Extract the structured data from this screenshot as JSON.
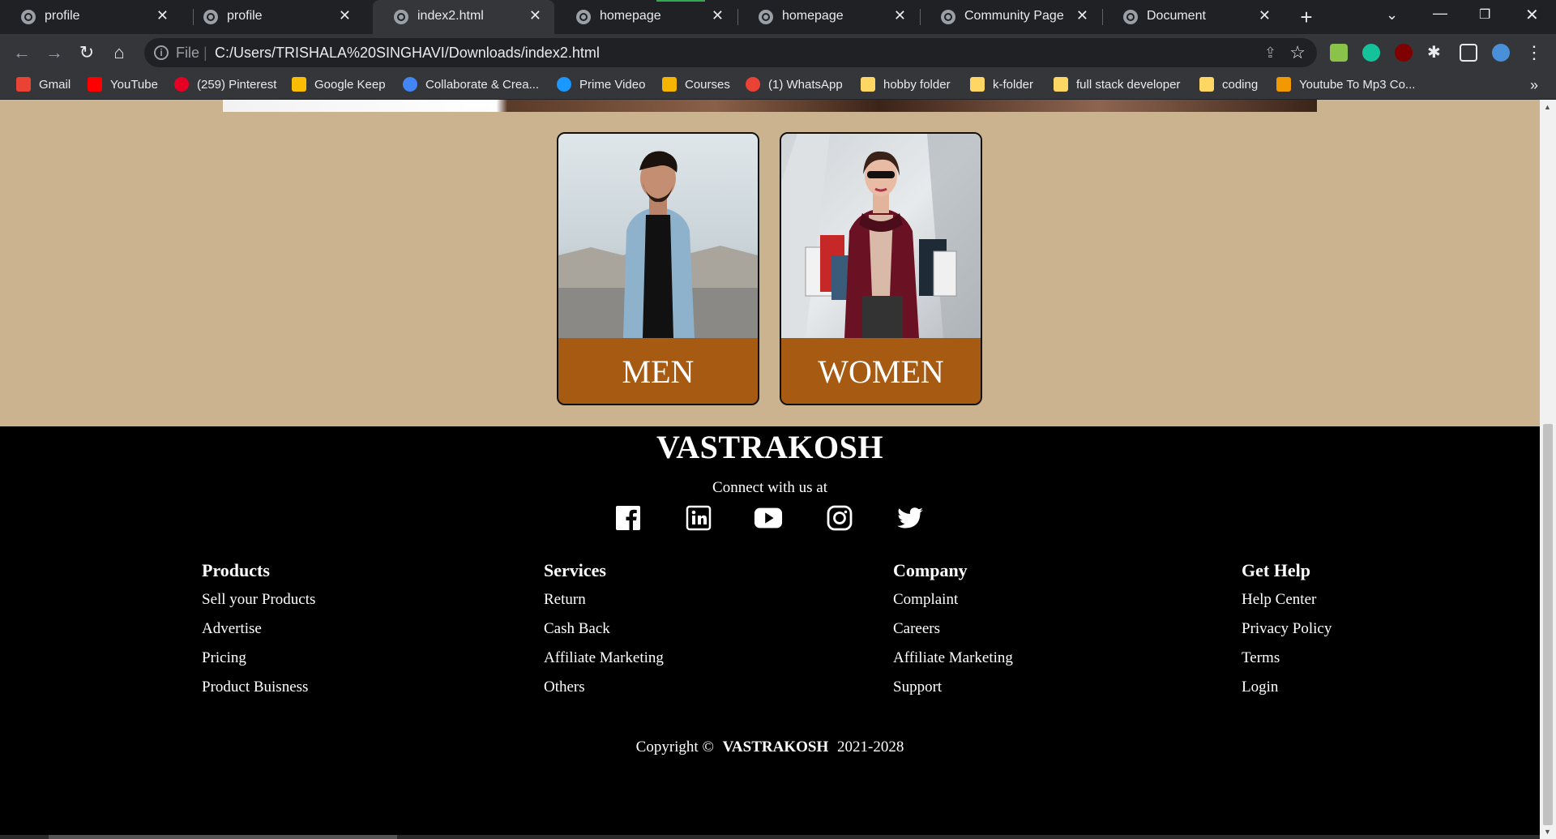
{
  "browser": {
    "tabs": [
      {
        "title": "profile"
      },
      {
        "title": "profile"
      },
      {
        "title": "index2.html"
      },
      {
        "title": "homepage"
      },
      {
        "title": "homepage"
      },
      {
        "title": "Community Page"
      },
      {
        "title": "Document"
      }
    ],
    "active_tab": 2,
    "address": {
      "scheme": "File",
      "url": "C:/Users/TRISHALA%20SINGHAVI/Downloads/index2.html"
    },
    "bookmarks": [
      {
        "label": "Gmail",
        "color": "#ea4335"
      },
      {
        "label": "YouTube",
        "color": "#ff0000"
      },
      {
        "label": "(259) Pinterest",
        "color": "#e60023"
      },
      {
        "label": "Google Keep",
        "color": "#fbbc04"
      },
      {
        "label": "Collaborate & Crea...",
        "color": "#4285f4"
      },
      {
        "label": "Prime Video",
        "color": "#1a98ff"
      },
      {
        "label": "Courses",
        "color": "#f4b400"
      },
      {
        "label": "(1) WhatsApp",
        "color": "#ea4335"
      },
      {
        "label": "hobby folder",
        "color": "#fdd663"
      },
      {
        "label": "k-folder",
        "color": "#fdd663"
      },
      {
        "label": "full stack developer",
        "color": "#fdd663"
      },
      {
        "label": "coding",
        "color": "#fdd663"
      },
      {
        "label": "Youtube To Mp3 Co...",
        "color": "#f29900"
      }
    ]
  },
  "page": {
    "categories": [
      {
        "label": "MEN"
      },
      {
        "label": "WOMEN"
      }
    ],
    "footer": {
      "brand": "VASTRAKOSH",
      "connect_text": "Connect with us at",
      "social_icons": [
        "facebook-icon",
        "linkedin-icon",
        "youtube-icon",
        "instagram-icon",
        "twitter-icon"
      ],
      "columns": [
        {
          "heading": "Products",
          "links": [
            "Sell your Products",
            "Advertise",
            "Pricing",
            "Product Buisness"
          ]
        },
        {
          "heading": "Services",
          "links": [
            "Return",
            "Cash Back",
            "Affiliate Marketing",
            "Others"
          ]
        },
        {
          "heading": "Company",
          "links": [
            "Complaint",
            "Careers",
            "Affiliate Marketing",
            "Support"
          ]
        },
        {
          "heading": "Get Help",
          "links": [
            "Help Center",
            "Privacy Policy",
            "Terms",
            "Login"
          ]
        }
      ],
      "copyright_prefix": "Copyright ©",
      "copyright_brand": "VASTRAKOSH",
      "copyright_years": "2021-2028"
    },
    "colors": {
      "section_bg": "#cbb38f",
      "card_label_bg": "#a75a12",
      "footer_bg": "#000000"
    }
  }
}
